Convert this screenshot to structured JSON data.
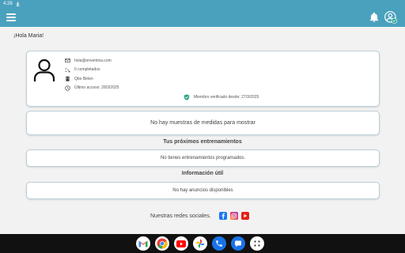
{
  "status_bar": {
    "time": "4:26"
  },
  "app_bar": {
    "bg_color": "#4aa1bd",
    "menu_icon": "hamburger-icon",
    "notifications_icon": "bell-icon",
    "profile_icon": "user-verified-icon"
  },
  "greeting": "¡Hola Maria!",
  "profile": {
    "email": "hola@enventiva.com",
    "completed": "0 completados",
    "location": "Qbo Belen",
    "last_access": "Último acceso: 28/3/2025",
    "verified": "Miembro verificado desde: 27/3/2025"
  },
  "measures": {
    "empty_text": "No hay muestras de medidas para mostrar"
  },
  "trainings": {
    "title": "Tus próximos entrenamientos",
    "empty_text": "No tienes entrenamientos programados."
  },
  "useful": {
    "title": "Información útil",
    "empty_text": "No hay anuncios disponibles"
  },
  "social": {
    "label": "Nuestras redes sociales.",
    "networks": [
      "facebook-icon",
      "instagram-icon",
      "youtube-icon"
    ]
  },
  "dock": {
    "apps": [
      "gmail-icon",
      "chrome-icon",
      "youtube-icon",
      "photos-icon",
      "phone-icon",
      "messages-icon",
      "app-drawer-icon"
    ]
  },
  "colors": {
    "accent": "#4aa1bd",
    "verified": "#2aa78a"
  }
}
